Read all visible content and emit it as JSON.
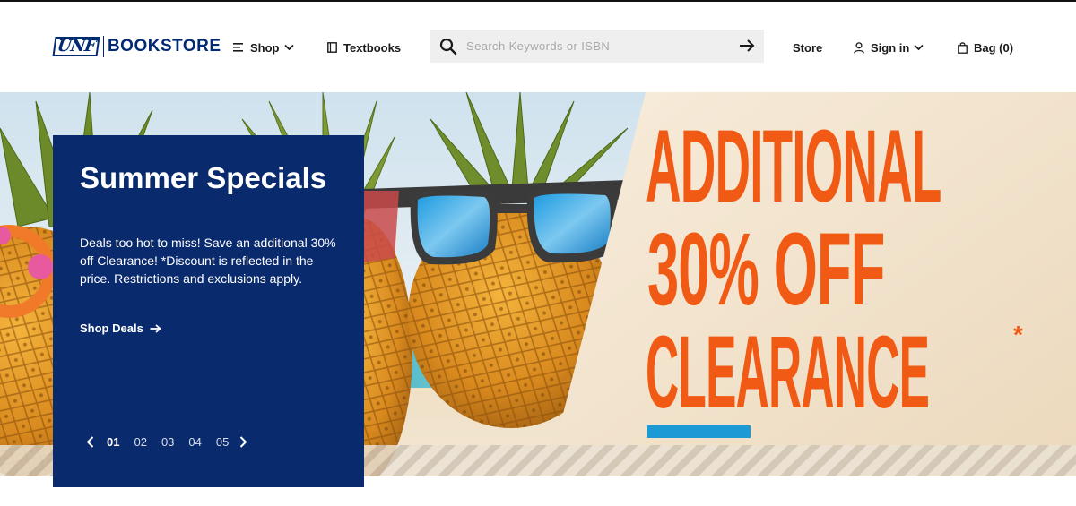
{
  "header": {
    "logo": {
      "mark": "UNF",
      "name": "BOOKSTORE"
    },
    "nav": {
      "shop": "Shop",
      "textbooks": "Textbooks",
      "store": "Store",
      "sign_in": "Sign in",
      "bag": "Bag (0)"
    },
    "search": {
      "placeholder": "Search Keywords or ISBN",
      "value": ""
    },
    "icons": {
      "shop": "list-icon",
      "shop_caret": "chevron-down-icon",
      "textbooks": "book-icon",
      "search": "search-icon",
      "submit": "arrow-right-icon",
      "sign_in": "user-icon",
      "sign_in_caret": "chevron-down-icon",
      "bag": "shopping-bag-icon"
    }
  },
  "hero": {
    "card": {
      "title": "Summer Specials",
      "description": "Deals too hot to miss! Save an additional 30% off Clearance! *Discount is reflected in the price. Restrictions and exclusions apply.",
      "cta": "Shop Deals"
    },
    "pager": {
      "pages": [
        "01",
        "02",
        "03",
        "04",
        "05"
      ],
      "active_index": 0
    },
    "banner": {
      "line1": "ADDITIONAL",
      "line2": "30% OFF",
      "line3": "CLEARANCE",
      "asterisk": "*"
    }
  },
  "colors": {
    "brand_navy": "#0a2a6e",
    "promo_orange": "#f15a14",
    "promo_blue_bar": "#1b9ad6",
    "search_bg": "#efefef"
  }
}
